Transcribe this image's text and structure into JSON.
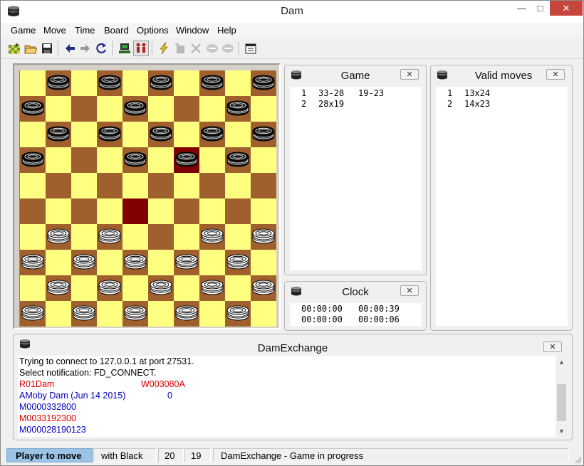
{
  "window": {
    "title": "Dam"
  },
  "menu": [
    "Game",
    "Move",
    "Time",
    "Board",
    "Options",
    "Window",
    "Help"
  ],
  "toolbar": {
    "buttons": [
      {
        "name": "new-game-icon"
      },
      {
        "name": "open-icon"
      },
      {
        "name": "save-icon"
      },
      {
        "name": "back-arrow-icon"
      },
      {
        "name": "forward-arrow-icon"
      },
      {
        "name": "refresh-icon"
      },
      {
        "name": "computer-icon"
      },
      {
        "name": "players-icon"
      },
      {
        "name": "lightning-icon"
      },
      {
        "name": "stop-icon"
      },
      {
        "name": "cross-icon"
      },
      {
        "name": "minus-disc-icon"
      },
      {
        "name": "minus-disc2-icon"
      },
      {
        "name": "properties-icon"
      }
    ]
  },
  "board": {
    "size": 10,
    "colors": {
      "light": "#ffff80",
      "dark": "#a0602e",
      "highlight": "#800000"
    },
    "black_pieces": [
      [
        0,
        1
      ],
      [
        0,
        3
      ],
      [
        0,
        5
      ],
      [
        0,
        7
      ],
      [
        0,
        9
      ],
      [
        1,
        0
      ],
      [
        1,
        4
      ],
      [
        1,
        8
      ],
      [
        2,
        1
      ],
      [
        2,
        3
      ],
      [
        2,
        5
      ],
      [
        2,
        7
      ],
      [
        2,
        9
      ],
      [
        3,
        0
      ],
      [
        3,
        4
      ],
      [
        3,
        6
      ],
      [
        3,
        8
      ]
    ],
    "white_pieces": [
      [
        6,
        1
      ],
      [
        6,
        3
      ],
      [
        6,
        7
      ],
      [
        6,
        9
      ],
      [
        7,
        0
      ],
      [
        7,
        2
      ],
      [
        7,
        4
      ],
      [
        7,
        6
      ],
      [
        7,
        8
      ],
      [
        8,
        1
      ],
      [
        8,
        3
      ],
      [
        8,
        5
      ],
      [
        8,
        7
      ],
      [
        8,
        9
      ],
      [
        9,
        0
      ],
      [
        9,
        2
      ],
      [
        9,
        4
      ],
      [
        9,
        6
      ],
      [
        9,
        8
      ]
    ],
    "highlighted": [
      [
        3,
        6
      ],
      [
        5,
        4
      ]
    ]
  },
  "game_panel": {
    "title": "Game",
    "moves": [
      {
        "num": "1",
        "white": "33-28",
        "black": "19-23"
      },
      {
        "num": "2",
        "white": "28x19",
        "black": ""
      }
    ]
  },
  "valid_moves_panel": {
    "title": "Valid moves",
    "moves": [
      {
        "num": "1",
        "move": "13x24"
      },
      {
        "num": "2",
        "move": "14x23"
      }
    ]
  },
  "clock_panel": {
    "title": "Clock",
    "rows": [
      {
        "a": "00:00:00",
        "b": "00:00:39"
      },
      {
        "a": "00:00:00",
        "b": "00:00:06"
      }
    ]
  },
  "dam_exchange": {
    "title": "DamExchange",
    "lines": [
      {
        "text": "Trying to connect to 127.0.0.1 at port 27531.",
        "color": "#000000"
      },
      {
        "text": "Select notification: FD_CONNECT.",
        "color": "#000000"
      },
      {
        "text": "R01Dam",
        "extra": "W003080A",
        "color": "#e00000"
      },
      {
        "text": "AMoby Dam (Jun 14 2015)",
        "extra": "0",
        "color": "#0000c0"
      },
      {
        "text": "M0000332800",
        "color": "#0000c0"
      },
      {
        "text": "M0033192300",
        "color": "#e00000"
      },
      {
        "text": "M000028190123",
        "color": "#0000c0"
      }
    ]
  },
  "status": {
    "player_to_move": "Player to move",
    "with_color": "with Black",
    "count_a": "20",
    "count_b": "19",
    "message": "DamExchange - Game in progress"
  }
}
